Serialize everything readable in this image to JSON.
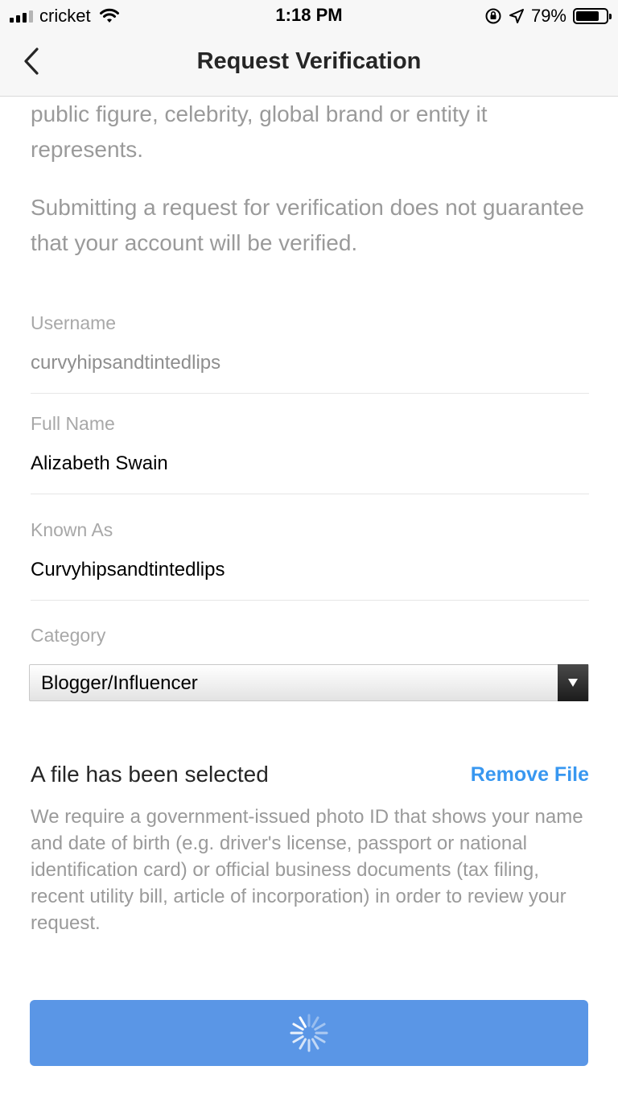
{
  "status_bar": {
    "carrier": "cricket",
    "time": "1:18 PM",
    "battery_percent": "79%",
    "battery_level": 0.79,
    "icons": [
      "signal-icon",
      "wifi-icon",
      "rotation-lock-icon",
      "location-arrow-icon",
      "battery-icon"
    ]
  },
  "nav": {
    "title": "Request Verification",
    "back_icon": "chevron-left-icon"
  },
  "intro": {
    "paragraph_1": "public figure, celebrity, global brand or entity it represents.",
    "paragraph_2": "Submitting a request for verification does not guarantee that your account will be verified."
  },
  "form": {
    "username": {
      "label": "Username",
      "value": "curvyhipsandtintedlips"
    },
    "full_name": {
      "label": "Full Name",
      "value": "Alizabeth Swain"
    },
    "known_as": {
      "label": "Known As",
      "value": "Curvyhipsandtintedlips"
    },
    "category": {
      "label": "Category",
      "selected": "Blogger/Influencer"
    }
  },
  "file": {
    "status": "A file has been selected",
    "remove_label": "Remove File",
    "help_text": "We require a government-issued photo ID that shows your name and date of birth (e.g. driver's license, passport or national identification card) or official business documents (tax filing, recent utility bill, article of incorporation) in order to review your request."
  },
  "submit": {
    "state": "loading",
    "icon": "spinner-icon"
  },
  "colors": {
    "accent": "#3897f0",
    "button": "#5a96e6",
    "muted_text": "#9a9a9a"
  }
}
